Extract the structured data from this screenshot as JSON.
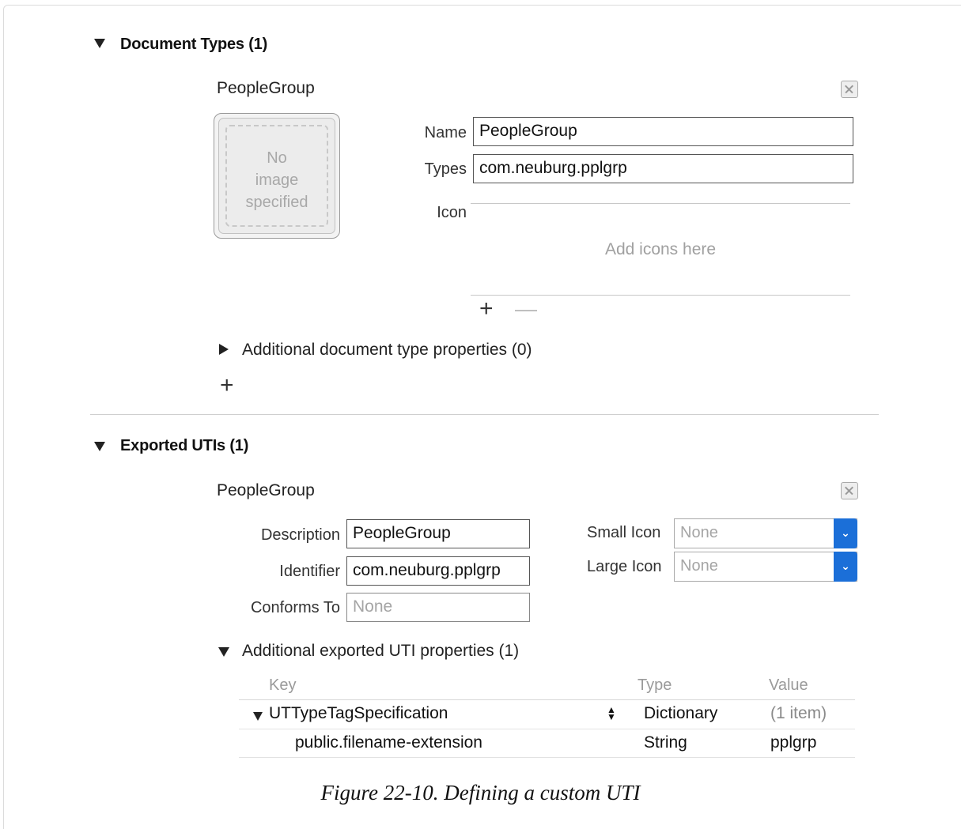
{
  "document_types": {
    "title": "Document Types (1)",
    "item_name": "PeopleGroup",
    "image_well": {
      "line1": "No",
      "line2": "image",
      "line3": "specified"
    },
    "name_label": "Name",
    "name_value": "PeopleGroup",
    "types_label": "Types",
    "types_value": "com.neuburg.pplgrp",
    "icon_label": "Icon",
    "icon_placeholder": "Add icons here",
    "add_symbol": "+",
    "remove_symbol": "—",
    "additional_props": "Additional document type properties (0)",
    "add_type_symbol": "+"
  },
  "exported_utis": {
    "title": "Exported UTIs (1)",
    "item_name": "PeopleGroup",
    "description_label": "Description",
    "description_value": "PeopleGroup",
    "identifier_label": "Identifier",
    "identifier_value": "com.neuburg.pplgrp",
    "conforms_label": "Conforms To",
    "conforms_placeholder": "None",
    "small_icon_label": "Small Icon",
    "small_icon_value": "None",
    "large_icon_label": "Large Icon",
    "large_icon_value": "None",
    "additional_props": "Additional exported UTI properties (1)",
    "table": {
      "headers": {
        "key": "Key",
        "type": "Type",
        "value": "Value"
      },
      "rows": [
        {
          "key": "UTTypeTagSpecification",
          "type": "Dictionary",
          "value": "(1 item)"
        },
        {
          "key": "public.filename-extension",
          "type": "String",
          "value": "pplgrp"
        }
      ]
    }
  },
  "caption": "Figure 22-10. Defining a custom UTI",
  "icons": {
    "close": "close-box-icon",
    "dropdown": "chevron-down-icon",
    "disclosure_open": "disclosure-down-icon",
    "disclosure_closed": "disclosure-right-icon",
    "stepper": "stepper-icon"
  },
  "colors": {
    "accent": "#1b6fd8",
    "divider": "#c8c8c8"
  }
}
